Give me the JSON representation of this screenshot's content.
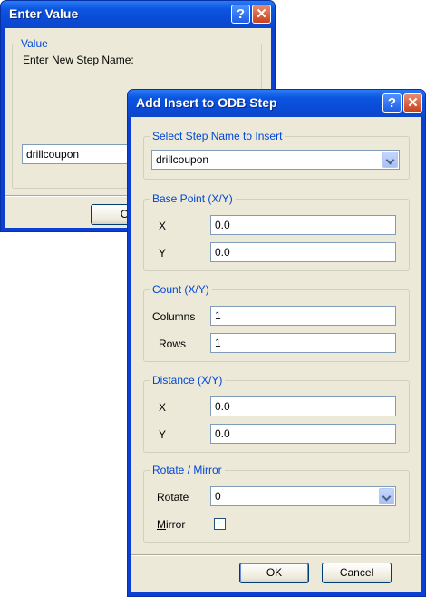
{
  "enter_value": {
    "title": "Enter Value",
    "group_label": "Value",
    "prompt": "Enter New Step Name:",
    "input_value": "drillcoupon",
    "ok_partial": "O"
  },
  "add_insert": {
    "title": "Add Insert to ODB Step",
    "step_group": {
      "label": "Select Step Name to Insert",
      "selected": "drillcoupon"
    },
    "base_point": {
      "label": "Base Point (X/Y)",
      "x_label": "X",
      "x_value": "0.0",
      "y_label": "Y",
      "y_value": "0.0"
    },
    "count": {
      "label": "Count (X/Y)",
      "columns_label": "Columns",
      "columns_value": "1",
      "rows_label": "Rows",
      "rows_value": "1"
    },
    "distance": {
      "label": "Distance (X/Y)",
      "x_label": "X",
      "x_value": "0.0",
      "y_label": "Y",
      "y_value": "0.0"
    },
    "rotate_mirror": {
      "label": "Rotate / Mirror",
      "rotate_label": "Rotate",
      "rotate_value": "0",
      "mirror_label_first": "M",
      "mirror_label_rest": "irror",
      "mirror_checked": false
    },
    "ok_label": "OK",
    "cancel_label": "Cancel"
  },
  "title_buttons": {
    "help": "?",
    "close": "✕"
  },
  "colors": {
    "xp_title_blue": "#0a4ad6",
    "dialog_face": "#ece9d8",
    "legend_blue": "#0046d5"
  }
}
